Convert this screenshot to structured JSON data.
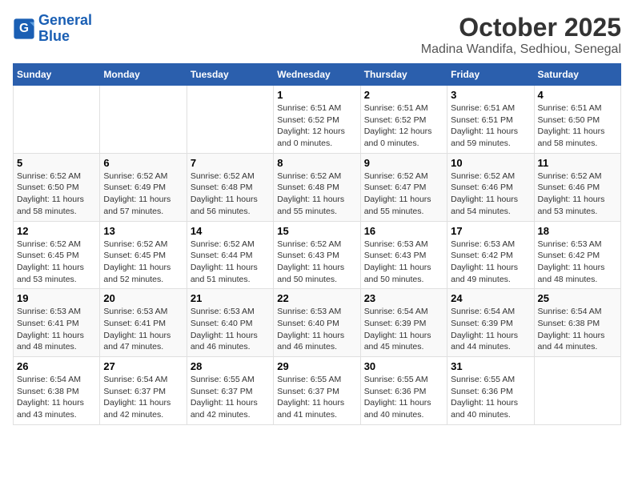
{
  "header": {
    "logo_line1": "General",
    "logo_line2": "Blue",
    "title": "October 2025",
    "subtitle": "Madina Wandifa, Sedhiou, Senegal"
  },
  "days_of_week": [
    "Sunday",
    "Monday",
    "Tuesday",
    "Wednesday",
    "Thursday",
    "Friday",
    "Saturday"
  ],
  "weeks": [
    [
      {
        "day": "",
        "info": ""
      },
      {
        "day": "",
        "info": ""
      },
      {
        "day": "",
        "info": ""
      },
      {
        "day": "1",
        "info": "Sunrise: 6:51 AM\nSunset: 6:52 PM\nDaylight: 12 hours\nand 0 minutes."
      },
      {
        "day": "2",
        "info": "Sunrise: 6:51 AM\nSunset: 6:52 PM\nDaylight: 12 hours\nand 0 minutes."
      },
      {
        "day": "3",
        "info": "Sunrise: 6:51 AM\nSunset: 6:51 PM\nDaylight: 11 hours\nand 59 minutes."
      },
      {
        "day": "4",
        "info": "Sunrise: 6:51 AM\nSunset: 6:50 PM\nDaylight: 11 hours\nand 58 minutes."
      }
    ],
    [
      {
        "day": "5",
        "info": "Sunrise: 6:52 AM\nSunset: 6:50 PM\nDaylight: 11 hours\nand 58 minutes."
      },
      {
        "day": "6",
        "info": "Sunrise: 6:52 AM\nSunset: 6:49 PM\nDaylight: 11 hours\nand 57 minutes."
      },
      {
        "day": "7",
        "info": "Sunrise: 6:52 AM\nSunset: 6:48 PM\nDaylight: 11 hours\nand 56 minutes."
      },
      {
        "day": "8",
        "info": "Sunrise: 6:52 AM\nSunset: 6:48 PM\nDaylight: 11 hours\nand 55 minutes."
      },
      {
        "day": "9",
        "info": "Sunrise: 6:52 AM\nSunset: 6:47 PM\nDaylight: 11 hours\nand 55 minutes."
      },
      {
        "day": "10",
        "info": "Sunrise: 6:52 AM\nSunset: 6:46 PM\nDaylight: 11 hours\nand 54 minutes."
      },
      {
        "day": "11",
        "info": "Sunrise: 6:52 AM\nSunset: 6:46 PM\nDaylight: 11 hours\nand 53 minutes."
      }
    ],
    [
      {
        "day": "12",
        "info": "Sunrise: 6:52 AM\nSunset: 6:45 PM\nDaylight: 11 hours\nand 53 minutes."
      },
      {
        "day": "13",
        "info": "Sunrise: 6:52 AM\nSunset: 6:45 PM\nDaylight: 11 hours\nand 52 minutes."
      },
      {
        "day": "14",
        "info": "Sunrise: 6:52 AM\nSunset: 6:44 PM\nDaylight: 11 hours\nand 51 minutes."
      },
      {
        "day": "15",
        "info": "Sunrise: 6:52 AM\nSunset: 6:43 PM\nDaylight: 11 hours\nand 50 minutes."
      },
      {
        "day": "16",
        "info": "Sunrise: 6:53 AM\nSunset: 6:43 PM\nDaylight: 11 hours\nand 50 minutes."
      },
      {
        "day": "17",
        "info": "Sunrise: 6:53 AM\nSunset: 6:42 PM\nDaylight: 11 hours\nand 49 minutes."
      },
      {
        "day": "18",
        "info": "Sunrise: 6:53 AM\nSunset: 6:42 PM\nDaylight: 11 hours\nand 48 minutes."
      }
    ],
    [
      {
        "day": "19",
        "info": "Sunrise: 6:53 AM\nSunset: 6:41 PM\nDaylight: 11 hours\nand 48 minutes."
      },
      {
        "day": "20",
        "info": "Sunrise: 6:53 AM\nSunset: 6:41 PM\nDaylight: 11 hours\nand 47 minutes."
      },
      {
        "day": "21",
        "info": "Sunrise: 6:53 AM\nSunset: 6:40 PM\nDaylight: 11 hours\nand 46 minutes."
      },
      {
        "day": "22",
        "info": "Sunrise: 6:53 AM\nSunset: 6:40 PM\nDaylight: 11 hours\nand 46 minutes."
      },
      {
        "day": "23",
        "info": "Sunrise: 6:54 AM\nSunset: 6:39 PM\nDaylight: 11 hours\nand 45 minutes."
      },
      {
        "day": "24",
        "info": "Sunrise: 6:54 AM\nSunset: 6:39 PM\nDaylight: 11 hours\nand 44 minutes."
      },
      {
        "day": "25",
        "info": "Sunrise: 6:54 AM\nSunset: 6:38 PM\nDaylight: 11 hours\nand 44 minutes."
      }
    ],
    [
      {
        "day": "26",
        "info": "Sunrise: 6:54 AM\nSunset: 6:38 PM\nDaylight: 11 hours\nand 43 minutes."
      },
      {
        "day": "27",
        "info": "Sunrise: 6:54 AM\nSunset: 6:37 PM\nDaylight: 11 hours\nand 42 minutes."
      },
      {
        "day": "28",
        "info": "Sunrise: 6:55 AM\nSunset: 6:37 PM\nDaylight: 11 hours\nand 42 minutes."
      },
      {
        "day": "29",
        "info": "Sunrise: 6:55 AM\nSunset: 6:37 PM\nDaylight: 11 hours\nand 41 minutes."
      },
      {
        "day": "30",
        "info": "Sunrise: 6:55 AM\nSunset: 6:36 PM\nDaylight: 11 hours\nand 40 minutes."
      },
      {
        "day": "31",
        "info": "Sunrise: 6:55 AM\nSunset: 6:36 PM\nDaylight: 11 hours\nand 40 minutes."
      },
      {
        "day": "",
        "info": ""
      }
    ]
  ]
}
